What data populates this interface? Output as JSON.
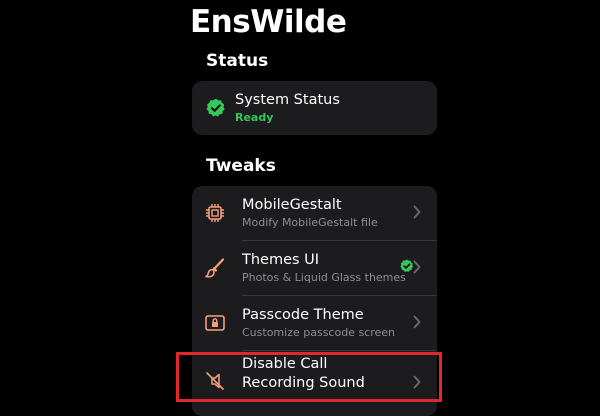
{
  "app": {
    "title": "EnsWilde"
  },
  "status_section": {
    "header": "Status",
    "item": {
      "icon": "verified-check-icon",
      "title": "System Status",
      "value": "Ready",
      "value_color": "#34c759"
    }
  },
  "tweaks_section": {
    "header": "Tweaks",
    "items": [
      {
        "icon": "chip-icon",
        "title": "MobileGestalt",
        "subtitle": "Modify MobileGestalt file",
        "badge": null
      },
      {
        "icon": "paintbrush-icon",
        "title": "Themes UI",
        "subtitle": "Photos & Liquid Glass themes",
        "badge": "verified-check-icon"
      },
      {
        "icon": "lock-screen-icon",
        "title": "Passcode Theme",
        "subtitle": "Customize passcode screen",
        "badge": null
      },
      {
        "icon": "speaker-mute-icon",
        "title": "Disable Call Recording Sound",
        "subtitle": "",
        "badge": null
      }
    ]
  },
  "colors": {
    "background": "#000000",
    "card": "#1c1c1e",
    "accent_icon": "#f4a07a",
    "ready_green": "#34c759",
    "highlight_red": "#e0282e"
  }
}
